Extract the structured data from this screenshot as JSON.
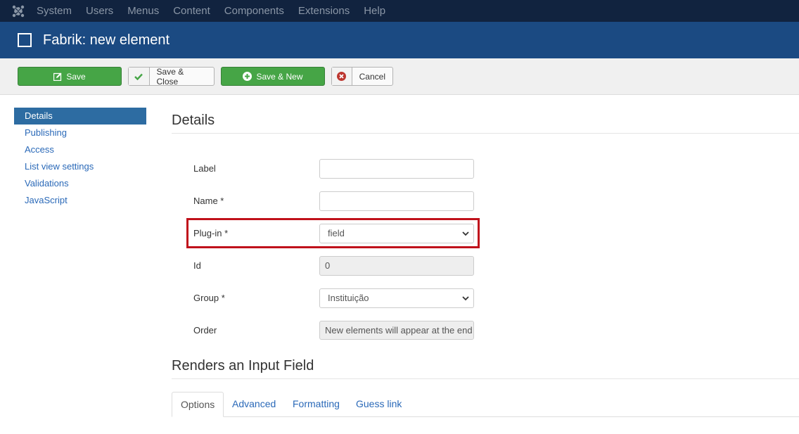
{
  "topbar": {
    "logo_icon": "joomla-logo-icon",
    "menu": [
      "System",
      "Users",
      "Menus",
      "Content",
      "Components",
      "Extensions",
      "Help"
    ]
  },
  "header": {
    "title": "Fabrik: new element",
    "icon": "checkbox-square-icon"
  },
  "toolbar": {
    "save": "Save",
    "save_close": "Save & Close",
    "save_new": "Save & New",
    "cancel": "Cancel"
  },
  "sidebar": {
    "items": [
      {
        "label": "Details",
        "active": true
      },
      {
        "label": "Publishing"
      },
      {
        "label": "Access"
      },
      {
        "label": "List view settings"
      },
      {
        "label": "Validations"
      },
      {
        "label": "JavaScript"
      }
    ]
  },
  "details": {
    "heading": "Details",
    "fields": {
      "label": {
        "label": "Label",
        "value": ""
      },
      "name": {
        "label": "Name *",
        "value": ""
      },
      "plugin": {
        "label": "Plug-in *",
        "value": "field"
      },
      "id": {
        "label": "Id",
        "value": "0"
      },
      "group": {
        "label": "Group *",
        "value": "Instituição"
      },
      "order": {
        "label": "Order",
        "value": "New elements will appear at the end"
      }
    }
  },
  "renders": {
    "heading": "Renders an Input Field",
    "tabs": [
      "Options",
      "Advanced",
      "Formatting",
      "Guess link"
    ]
  },
  "colors": {
    "topbar": "#11233f",
    "titlebar": "#1b4a82",
    "green": "#46a546",
    "highlight": "#c0111b"
  }
}
